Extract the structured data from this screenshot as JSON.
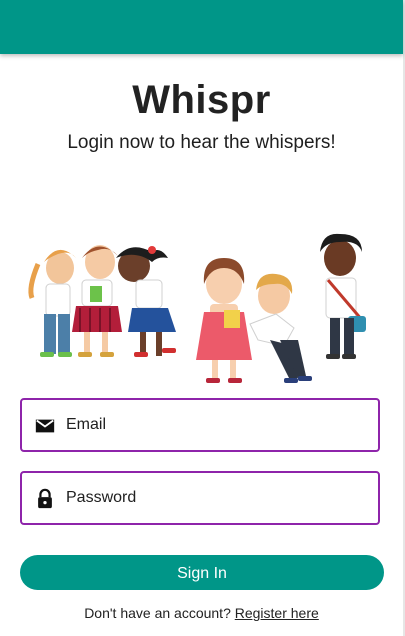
{
  "colors": {
    "brand": "#009688",
    "field_border": "#8e24aa"
  },
  "app": {
    "title": "Whispr",
    "subtitle": "Login now to hear the whispers!"
  },
  "form": {
    "email": {
      "placeholder": "Email",
      "value": "",
      "icon": "email-icon"
    },
    "password": {
      "placeholder": "Password",
      "value": "",
      "icon": "lock-icon"
    },
    "submit_label": "Sign In"
  },
  "footer": {
    "prompt": "Don't have an account? ",
    "link_label": "Register here"
  }
}
